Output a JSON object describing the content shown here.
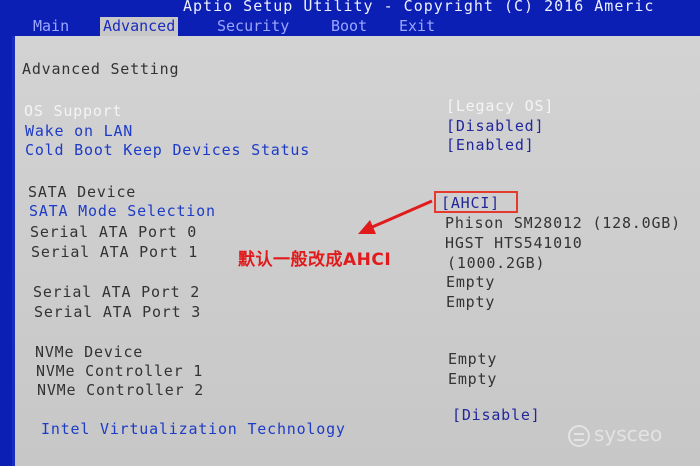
{
  "titlebar": {
    "text": "Aptio Setup Utility - Copyright (C) 2016 Americ"
  },
  "tabs": [
    {
      "label": "Main"
    },
    {
      "label": "Advanced"
    },
    {
      "label": "Security"
    },
    {
      "label": "Boot"
    },
    {
      "label": "Exit"
    }
  ],
  "panel": {
    "title": "Advanced Setting",
    "os_support": {
      "label": "OS Support",
      "value": "[Legacy OS]"
    },
    "wake_on_lan": {
      "label": "Wake on LAN",
      "value": "[Disabled]"
    },
    "cold_boot": {
      "label": "Cold Boot Keep Devices Status",
      "value": "[Enabled]"
    },
    "sata_device": {
      "label": "SATA Device"
    },
    "sata_mode": {
      "label": "SATA Mode Selection",
      "value": "[AHCI]"
    },
    "sata_port0": {
      "label": "Serial ATA Port 0",
      "value": "Phison SM28012 (128.0GB)"
    },
    "sata_port1": {
      "label": "Serial ATA Port 1",
      "value_line1": "HGST HTS541010",
      "value_line2": "(1000.2GB)"
    },
    "sata_port2": {
      "label": "Serial ATA Port 2",
      "value": "Empty"
    },
    "sata_port3": {
      "label": "Serial ATA Port 3",
      "value": "Empty"
    },
    "nvme_device": {
      "label": "NVMe Device"
    },
    "nvme_ctrl1": {
      "label": "NVMe Controller 1",
      "value": "Empty"
    },
    "nvme_ctrl2": {
      "label": "NVMe Controller 2",
      "value": "Empty"
    },
    "intel_vt": {
      "label": "Intel Virtualization Technology",
      "value": "[Disable]"
    }
  },
  "annotation": {
    "text": "默认一般改成AHCI",
    "color": "#e11b1b"
  },
  "watermark": {
    "text": "sysceo"
  },
  "colors": {
    "bios_blue": "#0b1fb4",
    "panel_gray": "#cfcfcf",
    "selectable_text": "#1d3bc6",
    "highlight_red": "#e53a2e"
  }
}
